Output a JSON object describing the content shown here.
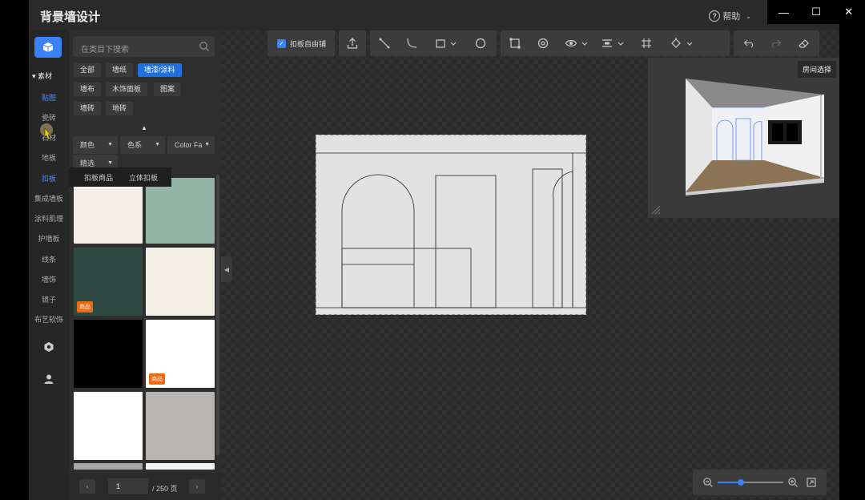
{
  "app": {
    "title": "背景墙设计",
    "help": "帮助"
  },
  "window_controls": [
    "—",
    "☐",
    "✕"
  ],
  "rail": {
    "section": "素材",
    "items": [
      {
        "label": "贴图",
        "active": true
      },
      {
        "label": "瓷砖",
        "active": false
      },
      {
        "label": "石材",
        "active": false
      },
      {
        "label": "地板",
        "active": false
      },
      {
        "label": "扣板",
        "active": true
      },
      {
        "label": "集成墙板",
        "active": false
      },
      {
        "label": "涂料肌理",
        "active": false
      },
      {
        "label": "护墙板",
        "active": false
      },
      {
        "label": "线条",
        "active": false
      },
      {
        "label": "墙饰",
        "active": false
      },
      {
        "label": "镜子",
        "active": false
      },
      {
        "label": "布艺软饰",
        "active": false
      }
    ]
  },
  "panel": {
    "search_placeholder": "在类目下搜索",
    "tags": [
      {
        "label": "全部",
        "active": false
      },
      {
        "label": "墙纸",
        "active": false
      },
      {
        "label": "墙漆/涂料",
        "active": true
      },
      {
        "label": "墙布",
        "active": false
      },
      {
        "label": "木饰面板",
        "active": false
      },
      {
        "label": "图案",
        "active": false
      },
      {
        "label": "墙砖",
        "active": false
      },
      {
        "label": "地砖",
        "active": false
      }
    ],
    "filters": [
      "颜色",
      "色系",
      "Color Fa",
      "精选"
    ],
    "subpopup": [
      "扣板商品",
      "立体扣板"
    ],
    "swatches": [
      {
        "color": "#f3efe6",
        "badge": ""
      },
      {
        "color": "#93b3a6",
        "badge": ""
      },
      {
        "color": "#2f4a42",
        "badge": "商品"
      },
      {
        "color": "#f2eee3",
        "badge": ""
      },
      {
        "color": "#000000",
        "badge": ""
      },
      {
        "color": "#ffffff",
        "badge": "商品"
      },
      {
        "color": "#ffffff",
        "badge": ""
      },
      {
        "color": "#b8b4b1",
        "badge": ""
      }
    ],
    "pager": {
      "prev": "‹",
      "next": "›",
      "page": "1",
      "total": "/ 250 页"
    }
  },
  "toolbar": {
    "free_paving_label": "扣板自由铺"
  },
  "preview": {
    "room_select": "房间选择"
  }
}
